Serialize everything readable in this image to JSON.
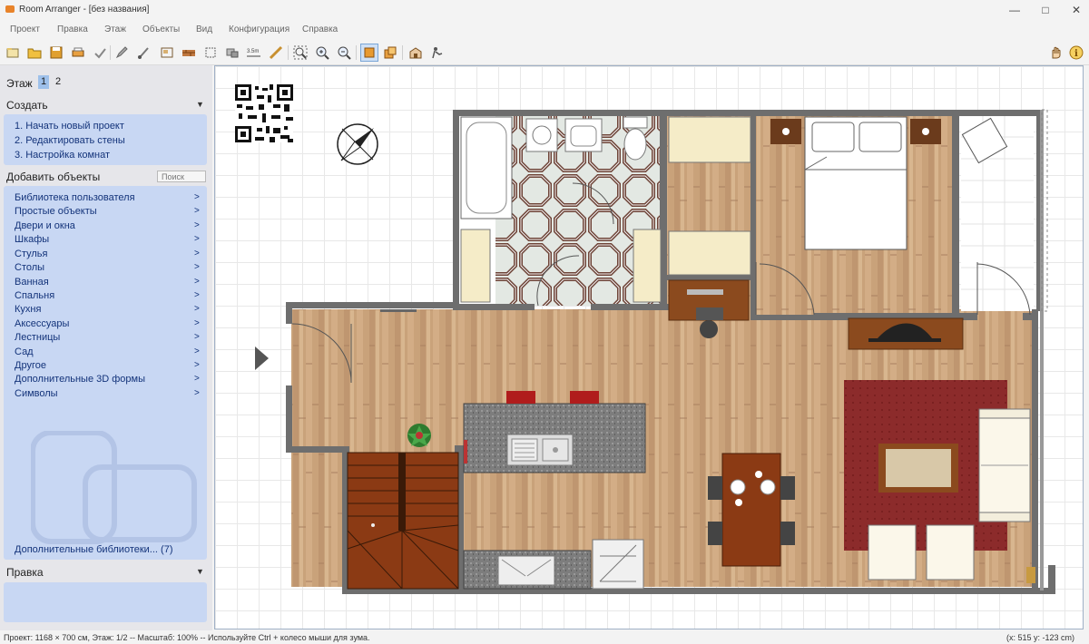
{
  "window": {
    "title": "Room Arranger - [без названия]"
  },
  "menu": [
    "Проект",
    "Правка",
    "Этаж",
    "Объекты",
    "Вид",
    "Конфигурация",
    "Справка"
  ],
  "floors": {
    "label": "Этаж",
    "tabs": [
      "1",
      "2"
    ],
    "active": "1"
  },
  "create": {
    "title": "Создать",
    "items": [
      "1. Начать новый проект",
      "2. Редактировать стены",
      "3. Настройка комнат"
    ]
  },
  "add_objects": {
    "title": "Добавить объекты",
    "search_placeholder": "Поиск",
    "items": [
      "Библиотека пользователя",
      "Простые объекты",
      "Двери и окна",
      "Шкафы",
      "Стулья",
      "Столы",
      "Ванная",
      "Спальня",
      "Кухня",
      "Аксессуары",
      "Лестницы",
      "Сад",
      "Другое",
      "Дополнительные 3D формы",
      "Символы"
    ],
    "more_libraries": "Дополнительные библиотеки... (7)"
  },
  "edit": {
    "title": "Правка"
  },
  "status": {
    "left": "Проект: 1168 × 700 см, Этаж: 1/2 -- Масштаб: 100% -- Используйте Ctrl + колесо мыши для зума.",
    "right": "(x: 515 y: -123 cm)"
  },
  "colors": {
    "accent": "#c8d7f3",
    "floor_wood": "#c9a27a",
    "wall": "#6e6e6e",
    "rug": "#8a2a2a"
  }
}
